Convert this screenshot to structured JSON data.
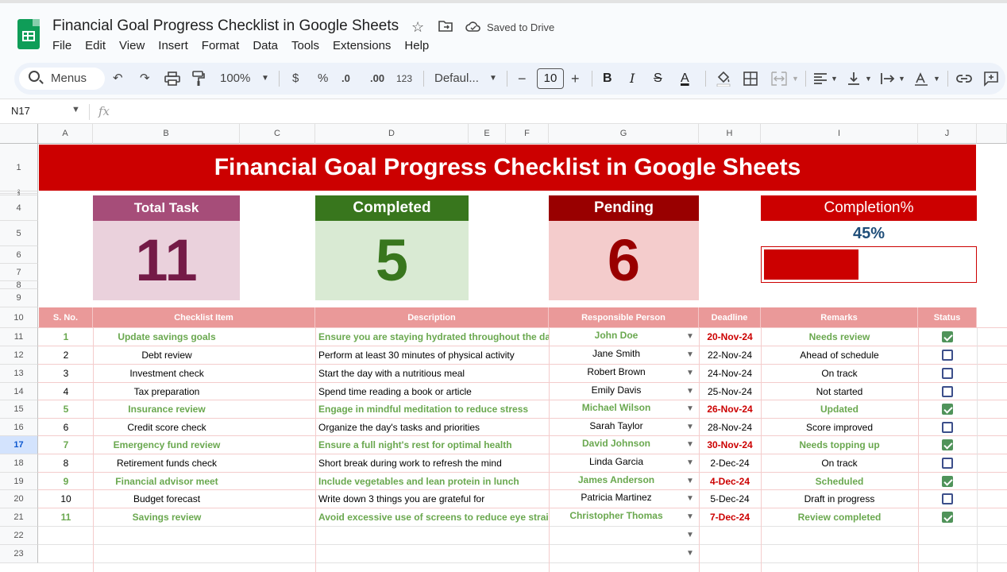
{
  "doc": {
    "title": "Financial Goal Progress Checklist in Google Sheets",
    "saved_status": "Saved to Drive"
  },
  "menu": [
    "File",
    "Edit",
    "View",
    "Insert",
    "Format",
    "Data",
    "Tools",
    "Extensions",
    "Help"
  ],
  "toolbar": {
    "search_label": "Menus",
    "zoom": "100%",
    "currency": "$",
    "percent": "%",
    "dec_decrease": ".0",
    "dec_increase": ".00",
    "number_format": "123",
    "font": "Defaul...",
    "font_size": "10",
    "minus": "−",
    "plus": "+",
    "bold": "B",
    "italic": "I",
    "text_color": "A"
  },
  "formula_bar": {
    "cell_ref": "N17",
    "fx": "fx"
  },
  "columns": [
    "A",
    "B",
    "C",
    "D",
    "E",
    "F",
    "G",
    "H",
    "I",
    "J"
  ],
  "rows": [
    "1",
    "2",
    "3",
    "4",
    "5",
    "6",
    "7",
    "8",
    "9",
    "10",
    "11",
    "12",
    "13",
    "14",
    "15",
    "16",
    "17",
    "18",
    "19",
    "20",
    "21",
    "22",
    "23"
  ],
  "selected_row": "17",
  "banner_title": "Financial Goal Progress Checklist in Google Sheets",
  "cards": {
    "total": {
      "label": "Total Task",
      "value": "11",
      "header_color": "#a64d79",
      "body_color": "#ead1dc",
      "value_color": "#741b47"
    },
    "completed": {
      "label": "Completed",
      "value": "5",
      "header_color": "#38761d",
      "body_color": "#d9ead3",
      "value_color": "#38761d"
    },
    "pending": {
      "label": "Pending",
      "value": "6",
      "header_color": "#990000",
      "body_color": "#f4cccc",
      "value_color": "#990000"
    }
  },
  "completion": {
    "label": "Completion%",
    "value_text": "45%",
    "fraction": 0.45,
    "color": "#cc0000"
  },
  "table": {
    "headers": [
      "S. No.",
      "Checklist Item",
      "Description",
      "Responsible Person",
      "Deadline",
      "Remarks",
      "Status"
    ],
    "rows": [
      {
        "sno": "1",
        "item": "Update savings goals",
        "desc": "Ensure you are staying hydrated throughout the day",
        "person": "John Doe",
        "deadline": "20-Nov-24",
        "remarks": "Needs review",
        "done": true
      },
      {
        "sno": "2",
        "item": "Debt review",
        "desc": "Perform at least 30 minutes of physical activity",
        "person": "Jane Smith",
        "deadline": "22-Nov-24",
        "remarks": "Ahead of schedule",
        "done": false
      },
      {
        "sno": "3",
        "item": "Investment check",
        "desc": "Start the day with a nutritious meal",
        "person": "Robert Brown",
        "deadline": "24-Nov-24",
        "remarks": "On track",
        "done": false
      },
      {
        "sno": "4",
        "item": "Tax preparation",
        "desc": "Spend time reading a book or article",
        "person": "Emily Davis",
        "deadline": "25-Nov-24",
        "remarks": "Not started",
        "done": false
      },
      {
        "sno": "5",
        "item": "Insurance review",
        "desc": "Engage in mindful meditation to reduce stress",
        "person": "Michael Wilson",
        "deadline": "26-Nov-24",
        "remarks": "Updated",
        "done": true
      },
      {
        "sno": "6",
        "item": "Credit score check",
        "desc": "Organize the day's tasks and priorities",
        "person": "Sarah Taylor",
        "deadline": "28-Nov-24",
        "remarks": "Score improved",
        "done": false
      },
      {
        "sno": "7",
        "item": "Emergency fund review",
        "desc": "Ensure a full night's rest for optimal health",
        "person": "David Johnson",
        "deadline": "30-Nov-24",
        "remarks": "Needs topping up",
        "done": true
      },
      {
        "sno": "8",
        "item": "Retirement funds check",
        "desc": "Short break during work to refresh the mind",
        "person": "Linda Garcia",
        "deadline": "2-Dec-24",
        "remarks": "On track",
        "done": false
      },
      {
        "sno": "9",
        "item": "Financial advisor meet",
        "desc": "Include vegetables and lean protein in lunch",
        "person": "James Anderson",
        "deadline": "4-Dec-24",
        "remarks": "Scheduled",
        "done": true
      },
      {
        "sno": "10",
        "item": "Budget forecast",
        "desc": "Write down 3 things you are grateful for",
        "person": "Patricia Martinez",
        "deadline": "5-Dec-24",
        "remarks": "Draft in progress",
        "done": false
      },
      {
        "sno": "11",
        "item": "Savings review",
        "desc": "Avoid excessive use of screens to reduce eye strain",
        "person": "Christopher Thomas",
        "deadline": "7-Dec-24",
        "remarks": "Review completed",
        "done": true
      }
    ]
  },
  "colors": {
    "banner": "#cc0000",
    "table_header": "#ea9999",
    "done_text": "#6aa84f"
  }
}
